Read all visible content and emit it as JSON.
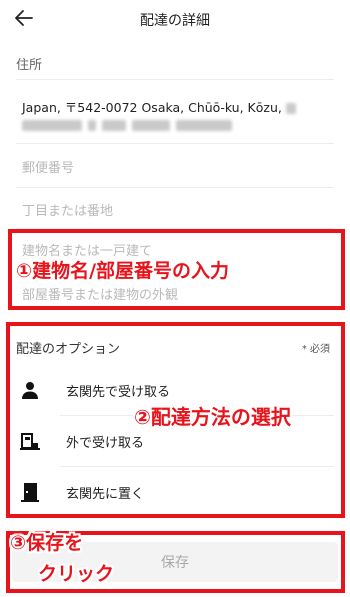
{
  "header": {
    "title": "配達の詳細"
  },
  "address_section": {
    "label": "住所",
    "address_text": "Japan, 〒542-0072 Osaka, Chūō-ku, Kōzu,"
  },
  "fields": {
    "postal_placeholder": "郵便番号",
    "street_placeholder": "丁目または番地",
    "building_placeholder": "建物名または一戸建て",
    "room_placeholder": "部屋番号または建物の外観"
  },
  "options": {
    "title": "配達のオプション",
    "required": "* 必須",
    "items": [
      {
        "label": "玄関先で受け取る",
        "icon": "person-icon"
      },
      {
        "label": "外で受け取る",
        "icon": "outside-delivery-icon"
      },
      {
        "label": "玄関先に置く",
        "icon": "door-icon"
      }
    ]
  },
  "save": {
    "label": "保存"
  },
  "annotations": {
    "step1": "①建物名/部屋番号の入力",
    "step2": "②配達方法の選択",
    "step3_line1": "③保存を",
    "step3_line2": "クリック"
  },
  "colors": {
    "annotation": "#e8141c",
    "text": "#222222",
    "placeholder": "#b9b9b9"
  }
}
